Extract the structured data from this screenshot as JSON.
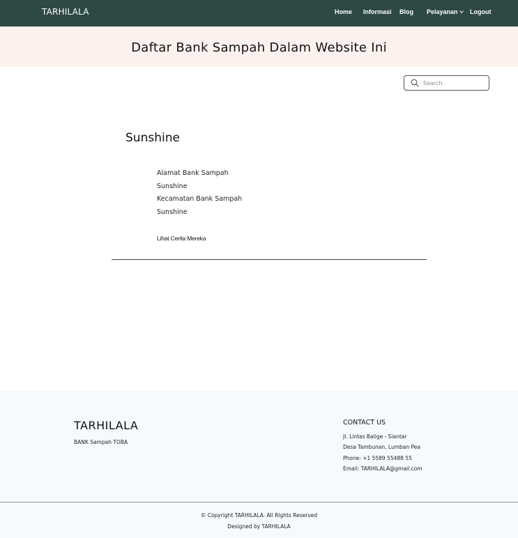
{
  "navbar": {
    "brand": "TARHILALA",
    "items": {
      "home": "Home",
      "informasi": "Informasi",
      "blog": "Blog",
      "pelayanan": "Pelayanan",
      "logout": "Logout"
    },
    "bg_color": "#2e4943"
  },
  "hero": {
    "title": "Daftar Bank Sampah Dalam Website Ini",
    "bg_color": "#fdf1ee"
  },
  "search": {
    "placeholder": "Search",
    "value": "",
    "icon": "search-icon"
  },
  "bank": {
    "name": "Sunshine",
    "address_label": "Alamat Bank Sampah",
    "address_value": "Sunshine",
    "district_label": "Kecamatan Bank Sampah",
    "district_value": "Sunshine",
    "story_link": "Lihat Cerita Mereka"
  },
  "footer": {
    "brand": "TARHILALA",
    "tagline": "BANK Sampah TOBA",
    "contact_heading": "CONTACT US",
    "address_line1": "Jl. Lintas Balige - Siantar",
    "address_line2": "Desa Tambunan, Lumban Pea",
    "phone": "Phone: +1 5589 55488 55",
    "email": "Email: TARHILALA@gmail.com",
    "copyright": "© Copyright TARHILALA. All Rights Reserved",
    "designed_by": "Designed by TARHILALA",
    "bg_color": "#f6fafc"
  }
}
